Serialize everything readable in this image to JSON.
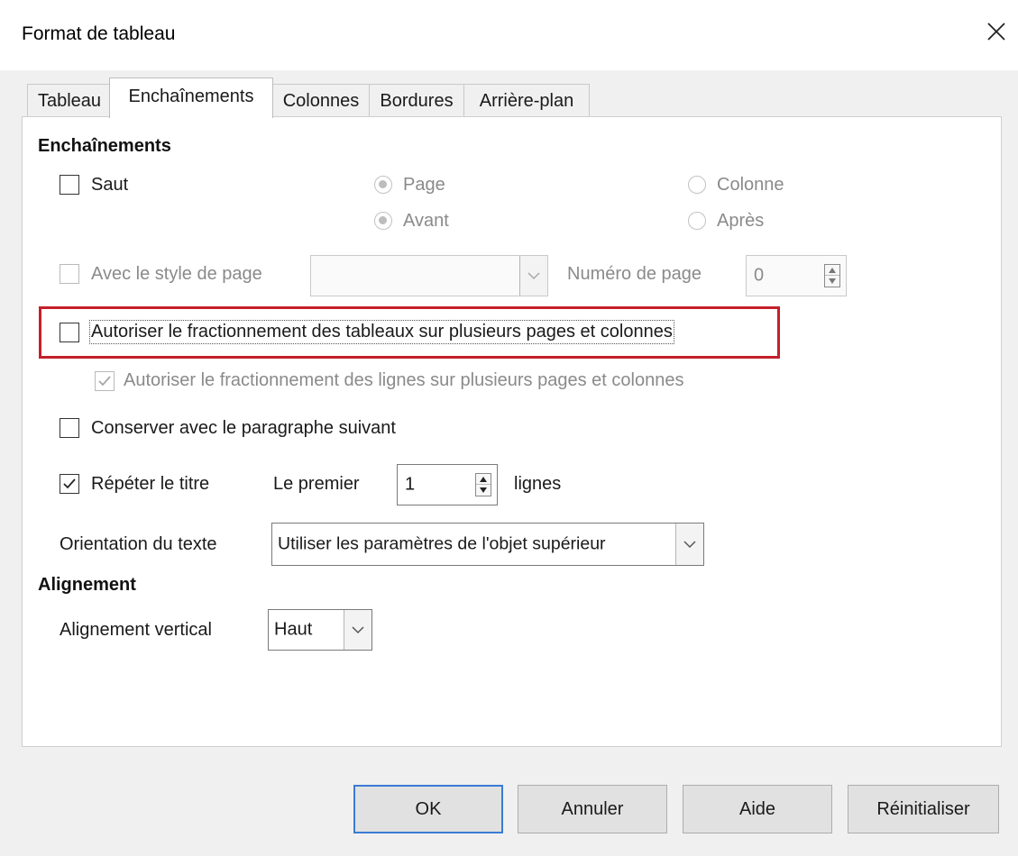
{
  "dialog": {
    "title": "Format de tableau"
  },
  "tabs": [
    {
      "label": "Tableau"
    },
    {
      "label": "Enchaînements"
    },
    {
      "label": "Colonnes"
    },
    {
      "label": "Bordures"
    },
    {
      "label": "Arrière-plan"
    }
  ],
  "enchainements": {
    "heading": "Enchaînements",
    "saut": {
      "label": "Saut",
      "checked": false
    },
    "radios": {
      "page": "Page",
      "colonne": "Colonne",
      "avant": "Avant",
      "apres": "Après"
    },
    "style_page": {
      "label": "Avec le style de page",
      "value": ""
    },
    "numero_page": {
      "label": "Numéro de page",
      "value": "0"
    },
    "fractionnement_tableaux": {
      "label": "Autoriser le fractionnement des tableaux sur plusieurs pages et colonnes",
      "checked": false
    },
    "fractionnement_lignes": {
      "label": "Autoriser le fractionnement des lignes sur plusieurs pages et colonnes",
      "checked": true
    },
    "conserver": {
      "label": "Conserver avec le paragraphe suivant",
      "checked": false
    },
    "repeter_titre": {
      "label": "Répéter le titre",
      "checked": true
    },
    "premier": {
      "label": "Le premier",
      "value": "1",
      "suffix": "lignes"
    },
    "orientation": {
      "label": "Orientation du texte",
      "value": "Utiliser les paramètres de l'objet supérieur"
    }
  },
  "alignement": {
    "heading": "Alignement",
    "vertical": {
      "label": "Alignement vertical",
      "value": "Haut"
    }
  },
  "buttons": {
    "ok": "OK",
    "annuler": "Annuler",
    "aide": "Aide",
    "reinitialiser": "Réinitialiser"
  },
  "colors": {
    "highlight": "#c4202a",
    "default_button_border": "#3a7bd5"
  },
  "icons": [
    "close-icon",
    "checkmark-icon",
    "chevron-down-icon",
    "spin-up-icon",
    "spin-down-icon"
  ]
}
